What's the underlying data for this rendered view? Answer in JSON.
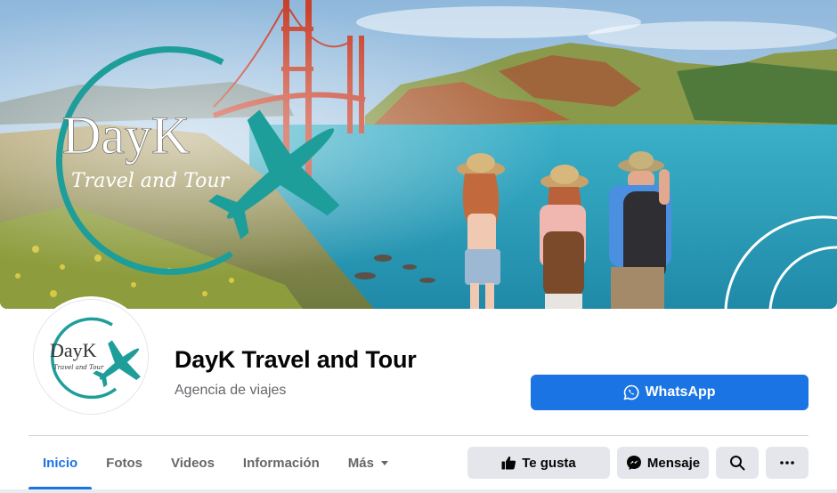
{
  "cover": {
    "logo_word": "DayK",
    "logo_tagline": "Travel and Tour"
  },
  "profile": {
    "name": "DayK Travel and Tour",
    "category": "Agencia de viajes",
    "avatar_logo_word": "DayK",
    "avatar_logo_tagline": "Travel and Tour"
  },
  "primary_action": {
    "label": "WhatsApp",
    "icon": "whatsapp-icon",
    "color": "#1b74e4"
  },
  "tabs": [
    {
      "label": "Inicio",
      "active": true
    },
    {
      "label": "Fotos",
      "active": false
    },
    {
      "label": "Videos",
      "active": false
    },
    {
      "label": "Información",
      "active": false
    },
    {
      "label": "Más",
      "active": false,
      "dropdown": true
    }
  ],
  "actions": {
    "like_label": "Te gusta",
    "like_icon": "thumbs-up-icon",
    "message_label": "Mensaje",
    "message_icon": "messenger-icon",
    "search_icon": "search-icon",
    "more_icon": "more-dots-icon"
  },
  "colors": {
    "accent": "#1b74e4",
    "logo_teal": "#1e9e9a",
    "text_primary": "#050505",
    "text_secondary": "#65676b",
    "button_gray": "#e4e6eb"
  }
}
